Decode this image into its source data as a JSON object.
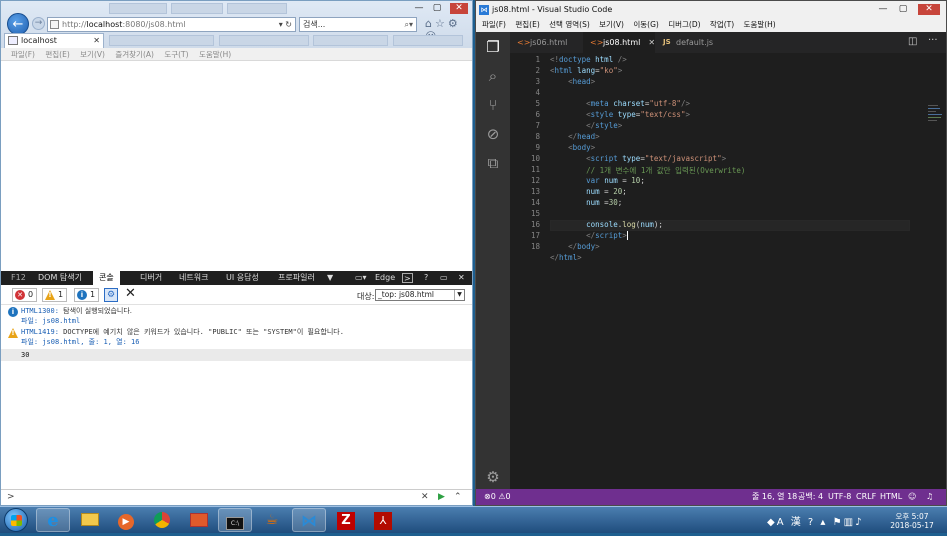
{
  "ie": {
    "url_prefix": "http://",
    "url_host": "localhost",
    "url_rest": ":8080/js08.html",
    "search_placeholder": "검색...",
    "tab_title": "localhost",
    "menu": [
      "파일(F)",
      "편집(E)",
      "보기(V)",
      "즐겨찾기(A)",
      "도구(T)",
      "도움말(H)"
    ],
    "devtools": {
      "f12_label": "F12",
      "tabs": [
        "DOM 탐색기",
        "콘솔",
        "디버거",
        "네트워크",
        "UI 응답성",
        "프로파일러"
      ],
      "active_tab": "콘솔",
      "emulation_label": "Edge",
      "counts": {
        "errors": "0",
        "warnings": "1",
        "infos": "1"
      },
      "target_label": "대상:",
      "target_value": "_top: js08.html",
      "messages": [
        {
          "type": "info",
          "code": "HTML1300:",
          "text": "탐색이 실행되었습니다.",
          "file": "파일: js08.html"
        },
        {
          "type": "warning",
          "code": "HTML1419:",
          "text": "DOCTYPE에 예기치 않은 키워드가 있습니다. \"PUBLIC\" 또는 \"SYSTEM\"이 필요합니다.",
          "file": "파일: js08.html, 줄: 1, 열: 16"
        }
      ],
      "output": "30",
      "prompt": ">"
    }
  },
  "vscode": {
    "title": "js08.html - Visual Studio Code",
    "menu": [
      "파일(F)",
      "편집(E)",
      "선택 영역(S)",
      "보기(V)",
      "이동(G)",
      "디버그(D)",
      "작업(T)",
      "도움말(H)"
    ],
    "tabs": [
      {
        "label": "js06.html",
        "icon": "<>",
        "active": false
      },
      {
        "label": "js08.html",
        "icon": "<>",
        "active": true
      },
      {
        "label": "default.js",
        "icon": "JS",
        "active": false
      }
    ],
    "line_numbers": [
      "1",
      "2",
      "3",
      "4",
      "5",
      "6",
      "7",
      "8",
      "9",
      "10",
      "11",
      "12",
      "13",
      "14",
      "15",
      "16",
      "17",
      "18"
    ],
    "status": {
      "problems": "⊗0 ⚠0",
      "position": "줄 16, 열 18",
      "spaces": "공백: 4",
      "encoding": "UTF-8",
      "eol": "CRLF",
      "language": "HTML"
    }
  },
  "taskbar": {
    "ime": "A 漢",
    "clock_ampm": "오후 5:07",
    "clock_date": "2018-05-17"
  },
  "colors": {
    "vscode_status": "#6f2f8f",
    "vscode_editor": "#1e1e1e",
    "ie_chrome": "#dfe9f5"
  }
}
